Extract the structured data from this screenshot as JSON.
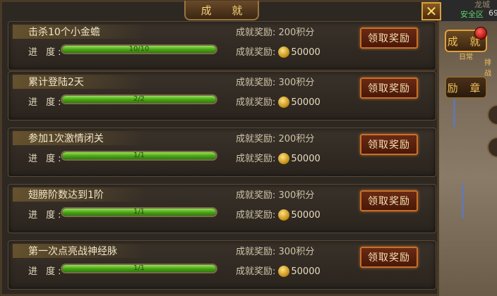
{
  "window": {
    "title": "成 就",
    "close_label": "✕"
  },
  "scene": {
    "top_text1": "龙城",
    "top_text2": "安全区",
    "top_text3": "69",
    "side_tabs": [
      {
        "label": "成 就",
        "active": true
      },
      {
        "label": "励 章",
        "active": false
      }
    ],
    "side_small1": "日常",
    "side_small2": "排战"
  },
  "achievements": [
    {
      "name": "击杀10个小金蟾",
      "progress_label": "进 度:",
      "progress_text": "10/10",
      "progress": 1.0,
      "reward_points": "成就奖励: 200积分",
      "reward_gold_label": "成就奖励:",
      "reward_gold": "50000",
      "claim_label": "领取奖励"
    },
    {
      "name": "累计登陆2天",
      "progress_label": "进 度:",
      "progress_text": "2/2",
      "progress": 1.0,
      "reward_points": "成就奖励: 300积分",
      "reward_gold_label": "成就奖励:",
      "reward_gold": "50000",
      "claim_label": "领取奖励"
    },
    {
      "name": "参加1次激情闭关",
      "progress_label": "进 度:",
      "progress_text": "1/1",
      "progress": 1.0,
      "reward_points": "成就奖励: 200积分",
      "reward_gold_label": "成就奖励:",
      "reward_gold": "50000",
      "claim_label": "领取奖励"
    },
    {
      "name": "翅膀阶数达到1阶",
      "progress_label": "进 度:",
      "progress_text": "1/1",
      "progress": 1.0,
      "reward_points": "成就奖励: 300积分",
      "reward_gold_label": "成就奖励:",
      "reward_gold": "50000",
      "claim_label": "领取奖励"
    },
    {
      "name": "第一次点亮战神经脉",
      "progress_label": "进 度:",
      "progress_text": "1/1",
      "progress": 1.0,
      "reward_points": "成就奖励: 300积分",
      "reward_gold_label": "成就奖励:",
      "reward_gold": "50000",
      "claim_label": "领取奖励"
    }
  ]
}
